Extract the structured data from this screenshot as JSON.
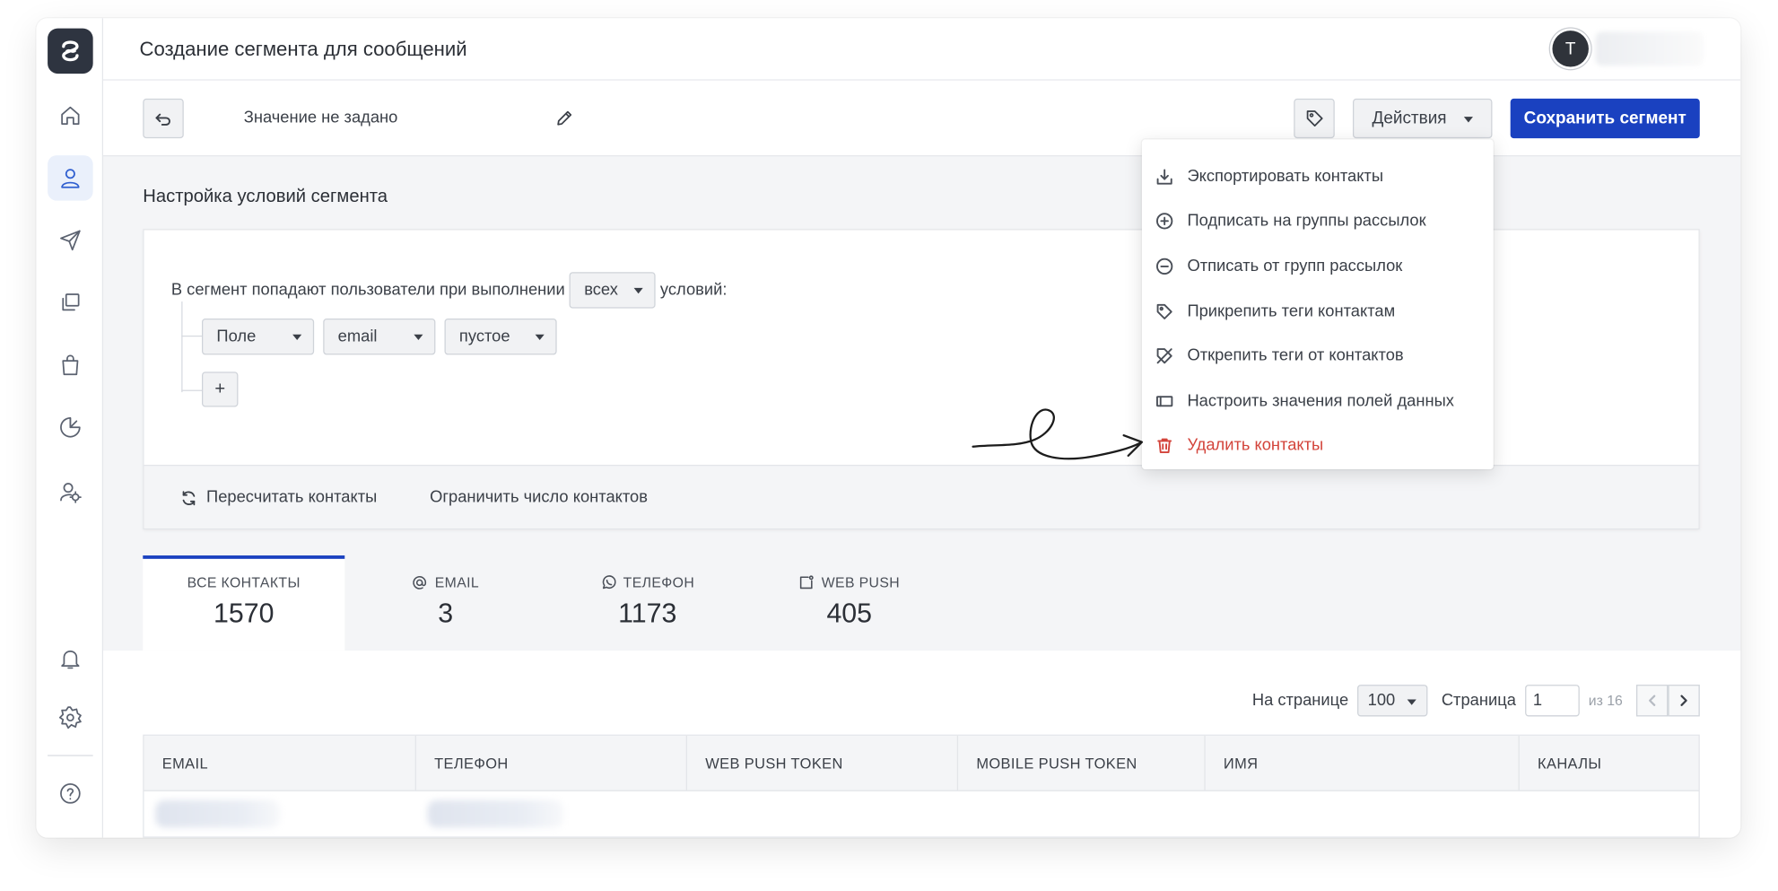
{
  "header": {
    "title": "Создание сегмента для сообщений",
    "avatar_letter": "T"
  },
  "toolbar": {
    "segment_name": "Значение не задано",
    "actions_label": "Действия",
    "save_label": "Сохранить сегмент"
  },
  "sidebar": {
    "items": [
      {
        "name": "home-icon"
      },
      {
        "name": "contacts-icon",
        "active": true
      },
      {
        "name": "send-icon"
      },
      {
        "name": "templates-icon"
      },
      {
        "name": "shop-icon"
      },
      {
        "name": "analytics-icon"
      },
      {
        "name": "users-settings-icon"
      },
      {
        "name": "bell-icon"
      },
      {
        "name": "gear-icon"
      },
      {
        "name": "help-icon"
      }
    ]
  },
  "segment": {
    "section_title": "Настройка условий сегмента",
    "rule_prefix": "В сегмент попадают пользователи при выполнении",
    "rule_match": "всех",
    "rule_suffix": "условий:",
    "condition": {
      "type": "Поле",
      "field": "email",
      "operator": "пустое"
    },
    "add_label": "+",
    "recalc_label": "Пересчитать контакты",
    "limit_label": "Ограничить число контактов"
  },
  "actions_menu": {
    "items": [
      {
        "label": "Экспортировать контакты",
        "icon": "download-icon"
      },
      {
        "label": "Подписать на группы рассылок",
        "icon": "plus-circle-icon"
      },
      {
        "label": "Отписать от групп рассылок",
        "icon": "minus-circle-icon"
      },
      {
        "label": "Прикрепить теги контактам",
        "icon": "tag-icon"
      },
      {
        "label": "Открепить теги от контактов",
        "icon": "tag-off-icon"
      },
      {
        "label": "Настроить значения полей данных",
        "icon": "field-icon"
      },
      {
        "label": "Удалить контакты",
        "icon": "trash-icon",
        "danger": true
      }
    ]
  },
  "tabs": [
    {
      "label": "ВСЕ КОНТАКТЫ",
      "count": "1570",
      "active": true
    },
    {
      "label": "EMAIL",
      "count": "3",
      "icon": "at-icon"
    },
    {
      "label": "ТЕЛЕФОН",
      "count": "1173",
      "icon": "whatsapp-icon"
    },
    {
      "label": "WEB PUSH",
      "count": "405",
      "icon": "webpush-icon"
    }
  ],
  "pager": {
    "per_page_label": "На странице",
    "per_page_value": "100",
    "page_label": "Страница",
    "page_value": "1",
    "of_label": "из 16"
  },
  "table": {
    "columns": [
      "EMAIL",
      "ТЕЛЕФОН",
      "WEB PUSH TOKEN",
      "MOBILE PUSH TOKEN",
      "ИМЯ",
      "КАНАЛЫ"
    ]
  },
  "colors": {
    "accent": "#1a41c0",
    "danger": "#d3443b",
    "active_nav": "#2f5fd0"
  }
}
